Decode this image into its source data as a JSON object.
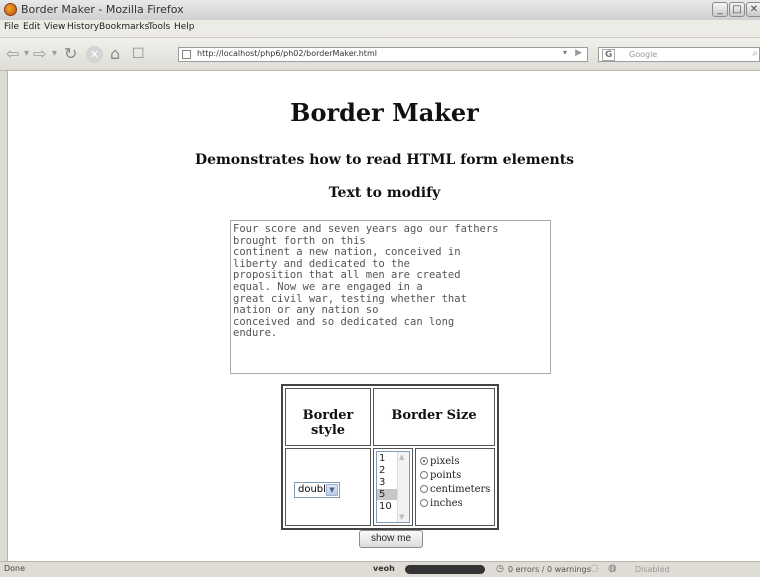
{
  "window": {
    "title": "Border Maker - Mozilla Firefox"
  },
  "menu": [
    "File",
    "Edit",
    "View",
    "History",
    "Bookmarks",
    "Tools",
    "Help"
  ],
  "navbar": {
    "url": "http://localhost/php6/ph02/borderMaker.html",
    "search_placeholder": "Google",
    "search_engine": "G"
  },
  "page": {
    "title": "Border Maker",
    "subtitle": "Demonstrates how to read HTML form elements",
    "text_heading": "Text to modify",
    "text": "Four score and seven years ago our fathers\nbrought forth on this\ncontinent a new nation, conceived in\nliberty and dedicated to the\nproposition that all men are created\nequal. Now we are engaged in a\ngreat civil war, testing whether that\nnation or any nation so\nconceived and so dedicated can long\nendure.",
    "border_style_header": "Border style",
    "border_size_header": "Border Size",
    "border_style_value": "double",
    "sizes": [
      "1",
      "2",
      "3",
      "5",
      "10"
    ],
    "selected_size": "5",
    "units": [
      "pixels",
      "points",
      "centimeters",
      "inches"
    ],
    "selected_unit": "pixels",
    "submit_label": "show me"
  },
  "status": {
    "text": "Done",
    "media": "veoh",
    "validator": "0 errors / 0 warnings",
    "disabled_label": "Disabled"
  }
}
